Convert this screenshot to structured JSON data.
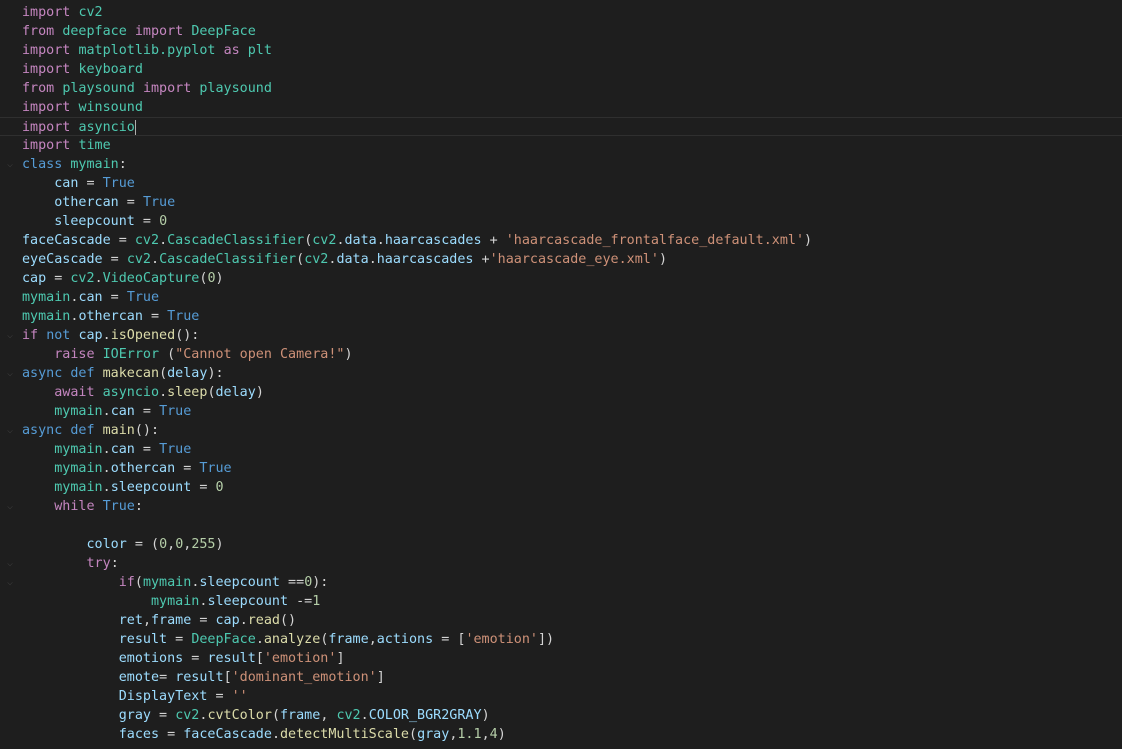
{
  "editor": {
    "theme": {
      "background": "#1e1e1e",
      "default": "#d4d4d4",
      "keyword": "#c586c0",
      "storage": "#569cd6",
      "function": "#dcdcaa",
      "class": "#4ec9b0",
      "variable": "#9cdcfe",
      "string": "#ce9178",
      "number": "#b5cea8",
      "dim_module": "#4ec9b0"
    },
    "cursor_line": 6,
    "lines": [
      {
        "fold": false,
        "tokens": [
          {
            "t": "import",
            "c": "keyword"
          },
          {
            "t": " "
          },
          {
            "t": "cv2",
            "c": "class"
          }
        ]
      },
      {
        "fold": false,
        "tokens": [
          {
            "t": "from",
            "c": "keyword"
          },
          {
            "t": " "
          },
          {
            "t": "deepface",
            "c": "class"
          },
          {
            "t": " "
          },
          {
            "t": "import",
            "c": "keyword"
          },
          {
            "t": " "
          },
          {
            "t": "DeepFace",
            "c": "class"
          }
        ]
      },
      {
        "fold": false,
        "tokens": [
          {
            "t": "import",
            "c": "keyword"
          },
          {
            "t": " "
          },
          {
            "t": "matplotlib.pyplot",
            "c": "class"
          },
          {
            "t": " "
          },
          {
            "t": "as",
            "c": "keyword"
          },
          {
            "t": " "
          },
          {
            "t": "plt",
            "c": "dim_module"
          }
        ]
      },
      {
        "fold": false,
        "tokens": [
          {
            "t": "import",
            "c": "keyword"
          },
          {
            "t": " "
          },
          {
            "t": "keyboard",
            "c": "dim_module"
          }
        ]
      },
      {
        "fold": false,
        "tokens": [
          {
            "t": "from",
            "c": "keyword"
          },
          {
            "t": " "
          },
          {
            "t": "playsound",
            "c": "class"
          },
          {
            "t": " "
          },
          {
            "t": "import",
            "c": "keyword"
          },
          {
            "t": " "
          },
          {
            "t": "playsound",
            "c": "class"
          }
        ]
      },
      {
        "fold": false,
        "tokens": [
          {
            "t": "import",
            "c": "keyword"
          },
          {
            "t": " "
          },
          {
            "t": "winsound",
            "c": "class"
          }
        ]
      },
      {
        "fold": false,
        "tokens": [
          {
            "t": "import",
            "c": "keyword"
          },
          {
            "t": " "
          },
          {
            "t": "asyncio",
            "c": "class"
          }
        ]
      },
      {
        "fold": false,
        "tokens": [
          {
            "t": "import",
            "c": "keyword"
          },
          {
            "t": " "
          },
          {
            "t": "time",
            "c": "dim_module"
          }
        ]
      },
      {
        "fold": true,
        "tokens": [
          {
            "t": "class",
            "c": "storage"
          },
          {
            "t": " "
          },
          {
            "t": "mymain",
            "c": "class"
          },
          {
            "t": ":"
          }
        ]
      },
      {
        "fold": false,
        "tokens": [
          {
            "t": "    "
          },
          {
            "t": "can",
            "c": "variable"
          },
          {
            "t": " = "
          },
          {
            "t": "True",
            "c": "storage"
          }
        ]
      },
      {
        "fold": false,
        "tokens": [
          {
            "t": "    "
          },
          {
            "t": "othercan",
            "c": "variable"
          },
          {
            "t": " = "
          },
          {
            "t": "True",
            "c": "storage"
          }
        ]
      },
      {
        "fold": false,
        "tokens": [
          {
            "t": "    "
          },
          {
            "t": "sleepcount",
            "c": "variable"
          },
          {
            "t": " = "
          },
          {
            "t": "0",
            "c": "number"
          }
        ]
      },
      {
        "fold": false,
        "tokens": [
          {
            "t": "faceCascade",
            "c": "variable"
          },
          {
            "t": " = "
          },
          {
            "t": "cv2",
            "c": "class"
          },
          {
            "t": "."
          },
          {
            "t": "CascadeClassifier",
            "c": "class"
          },
          {
            "t": "("
          },
          {
            "t": "cv2",
            "c": "class"
          },
          {
            "t": "."
          },
          {
            "t": "data",
            "c": "variable"
          },
          {
            "t": "."
          },
          {
            "t": "haarcascades",
            "c": "variable"
          },
          {
            "t": " + "
          },
          {
            "t": "'haarcascade_frontalface_default.xml'",
            "c": "string"
          },
          {
            "t": ")"
          }
        ]
      },
      {
        "fold": false,
        "tokens": [
          {
            "t": "eyeCascade",
            "c": "variable"
          },
          {
            "t": " = "
          },
          {
            "t": "cv2",
            "c": "class"
          },
          {
            "t": "."
          },
          {
            "t": "CascadeClassifier",
            "c": "class"
          },
          {
            "t": "("
          },
          {
            "t": "cv2",
            "c": "class"
          },
          {
            "t": "."
          },
          {
            "t": "data",
            "c": "variable"
          },
          {
            "t": "."
          },
          {
            "t": "haarcascades",
            "c": "variable"
          },
          {
            "t": " +"
          },
          {
            "t": "'haarcascade_eye.xml'",
            "c": "string"
          },
          {
            "t": ")"
          }
        ]
      },
      {
        "fold": false,
        "tokens": [
          {
            "t": "cap",
            "c": "variable"
          },
          {
            "t": " = "
          },
          {
            "t": "cv2",
            "c": "class"
          },
          {
            "t": "."
          },
          {
            "t": "VideoCapture",
            "c": "class"
          },
          {
            "t": "("
          },
          {
            "t": "0",
            "c": "number"
          },
          {
            "t": ")"
          }
        ]
      },
      {
        "fold": false,
        "tokens": [
          {
            "t": "mymain",
            "c": "class"
          },
          {
            "t": "."
          },
          {
            "t": "can",
            "c": "variable"
          },
          {
            "t": " = "
          },
          {
            "t": "True",
            "c": "storage"
          }
        ]
      },
      {
        "fold": false,
        "tokens": [
          {
            "t": "mymain",
            "c": "class"
          },
          {
            "t": "."
          },
          {
            "t": "othercan",
            "c": "variable"
          },
          {
            "t": " = "
          },
          {
            "t": "True",
            "c": "storage"
          }
        ]
      },
      {
        "fold": true,
        "tokens": [
          {
            "t": "if",
            "c": "keyword"
          },
          {
            "t": " "
          },
          {
            "t": "not",
            "c": "storage"
          },
          {
            "t": " "
          },
          {
            "t": "cap",
            "c": "variable"
          },
          {
            "t": "."
          },
          {
            "t": "isOpened",
            "c": "function"
          },
          {
            "t": "():"
          }
        ]
      },
      {
        "fold": false,
        "tokens": [
          {
            "t": "    "
          },
          {
            "t": "raise",
            "c": "keyword"
          },
          {
            "t": " "
          },
          {
            "t": "IOError",
            "c": "class"
          },
          {
            "t": " ("
          },
          {
            "t": "\"Cannot open Camera!\"",
            "c": "string"
          },
          {
            "t": ")"
          }
        ]
      },
      {
        "fold": true,
        "tokens": [
          {
            "t": "async",
            "c": "storage"
          },
          {
            "t": " "
          },
          {
            "t": "def",
            "c": "storage"
          },
          {
            "t": " "
          },
          {
            "t": "makecan",
            "c": "function"
          },
          {
            "t": "("
          },
          {
            "t": "delay",
            "c": "variable"
          },
          {
            "t": "):"
          }
        ]
      },
      {
        "fold": false,
        "tokens": [
          {
            "t": "    "
          },
          {
            "t": "await",
            "c": "keyword"
          },
          {
            "t": " "
          },
          {
            "t": "asyncio",
            "c": "class"
          },
          {
            "t": "."
          },
          {
            "t": "sleep",
            "c": "function"
          },
          {
            "t": "("
          },
          {
            "t": "delay",
            "c": "variable"
          },
          {
            "t": ")"
          }
        ]
      },
      {
        "fold": false,
        "tokens": [
          {
            "t": "    "
          },
          {
            "t": "mymain",
            "c": "class"
          },
          {
            "t": "."
          },
          {
            "t": "can",
            "c": "variable"
          },
          {
            "t": " = "
          },
          {
            "t": "True",
            "c": "storage"
          }
        ]
      },
      {
        "fold": true,
        "tokens": [
          {
            "t": "async",
            "c": "storage"
          },
          {
            "t": " "
          },
          {
            "t": "def",
            "c": "storage"
          },
          {
            "t": " "
          },
          {
            "t": "main",
            "c": "function"
          },
          {
            "t": "():"
          }
        ]
      },
      {
        "fold": false,
        "tokens": [
          {
            "t": "    "
          },
          {
            "t": "mymain",
            "c": "class"
          },
          {
            "t": "."
          },
          {
            "t": "can",
            "c": "variable"
          },
          {
            "t": " = "
          },
          {
            "t": "True",
            "c": "storage"
          }
        ]
      },
      {
        "fold": false,
        "tokens": [
          {
            "t": "    "
          },
          {
            "t": "mymain",
            "c": "class"
          },
          {
            "t": "."
          },
          {
            "t": "othercan",
            "c": "variable"
          },
          {
            "t": " = "
          },
          {
            "t": "True",
            "c": "storage"
          }
        ]
      },
      {
        "fold": false,
        "tokens": [
          {
            "t": "    "
          },
          {
            "t": "mymain",
            "c": "class"
          },
          {
            "t": "."
          },
          {
            "t": "sleepcount",
            "c": "variable"
          },
          {
            "t": " = "
          },
          {
            "t": "0",
            "c": "number"
          }
        ]
      },
      {
        "fold": true,
        "tokens": [
          {
            "t": "    "
          },
          {
            "t": "while",
            "c": "keyword"
          },
          {
            "t": " "
          },
          {
            "t": "True",
            "c": "storage"
          },
          {
            "t": ":"
          }
        ]
      },
      {
        "fold": false,
        "tokens": []
      },
      {
        "fold": false,
        "tokens": [
          {
            "t": "        "
          },
          {
            "t": "color",
            "c": "variable"
          },
          {
            "t": " = ("
          },
          {
            "t": "0",
            "c": "number"
          },
          {
            "t": ","
          },
          {
            "t": "0",
            "c": "number"
          },
          {
            "t": ","
          },
          {
            "t": "255",
            "c": "number"
          },
          {
            "t": ")"
          }
        ]
      },
      {
        "fold": true,
        "tokens": [
          {
            "t": "        "
          },
          {
            "t": "try",
            "c": "keyword"
          },
          {
            "t": ":"
          }
        ]
      },
      {
        "fold": true,
        "tokens": [
          {
            "t": "            "
          },
          {
            "t": "if",
            "c": "keyword"
          },
          {
            "t": "("
          },
          {
            "t": "mymain",
            "c": "class"
          },
          {
            "t": "."
          },
          {
            "t": "sleepcount",
            "c": "variable"
          },
          {
            "t": " =="
          },
          {
            "t": "0",
            "c": "number"
          },
          {
            "t": "):"
          }
        ]
      },
      {
        "fold": false,
        "tokens": [
          {
            "t": "                "
          },
          {
            "t": "mymain",
            "c": "class"
          },
          {
            "t": "."
          },
          {
            "t": "sleepcount",
            "c": "variable"
          },
          {
            "t": " -="
          },
          {
            "t": "1",
            "c": "number"
          }
        ]
      },
      {
        "fold": false,
        "tokens": [
          {
            "t": "            "
          },
          {
            "t": "ret",
            "c": "variable"
          },
          {
            "t": ","
          },
          {
            "t": "frame",
            "c": "variable"
          },
          {
            "t": " = "
          },
          {
            "t": "cap",
            "c": "variable"
          },
          {
            "t": "."
          },
          {
            "t": "read",
            "c": "function"
          },
          {
            "t": "()"
          }
        ]
      },
      {
        "fold": false,
        "tokens": [
          {
            "t": "            "
          },
          {
            "t": "result",
            "c": "variable"
          },
          {
            "t": " = "
          },
          {
            "t": "DeepFace",
            "c": "class"
          },
          {
            "t": "."
          },
          {
            "t": "analyze",
            "c": "function"
          },
          {
            "t": "("
          },
          {
            "t": "frame",
            "c": "variable"
          },
          {
            "t": ","
          },
          {
            "t": "actions",
            "c": "variable"
          },
          {
            "t": " = ["
          },
          {
            "t": "'emotion'",
            "c": "string"
          },
          {
            "t": "])"
          }
        ]
      },
      {
        "fold": false,
        "tokens": [
          {
            "t": "            "
          },
          {
            "t": "emotions",
            "c": "variable"
          },
          {
            "t": " = "
          },
          {
            "t": "result",
            "c": "variable"
          },
          {
            "t": "["
          },
          {
            "t": "'emotion'",
            "c": "string"
          },
          {
            "t": "]"
          }
        ]
      },
      {
        "fold": false,
        "tokens": [
          {
            "t": "            "
          },
          {
            "t": "emote",
            "c": "variable"
          },
          {
            "t": "= "
          },
          {
            "t": "result",
            "c": "variable"
          },
          {
            "t": "["
          },
          {
            "t": "'dominant_emotion'",
            "c": "string"
          },
          {
            "t": "]"
          }
        ]
      },
      {
        "fold": false,
        "tokens": [
          {
            "t": "            "
          },
          {
            "t": "DisplayText",
            "c": "variable"
          },
          {
            "t": " = "
          },
          {
            "t": "''",
            "c": "string"
          }
        ]
      },
      {
        "fold": false,
        "tokens": [
          {
            "t": "            "
          },
          {
            "t": "gray",
            "c": "variable"
          },
          {
            "t": " = "
          },
          {
            "t": "cv2",
            "c": "class"
          },
          {
            "t": "."
          },
          {
            "t": "cvtColor",
            "c": "function"
          },
          {
            "t": "("
          },
          {
            "t": "frame",
            "c": "variable"
          },
          {
            "t": ", "
          },
          {
            "t": "cv2",
            "c": "class"
          },
          {
            "t": "."
          },
          {
            "t": "COLOR_BGR2GRAY",
            "c": "variable"
          },
          {
            "t": ")"
          }
        ]
      },
      {
        "fold": false,
        "tokens": [
          {
            "t": "            "
          },
          {
            "t": "faces",
            "c": "variable"
          },
          {
            "t": " = "
          },
          {
            "t": "faceCascade",
            "c": "variable"
          },
          {
            "t": "."
          },
          {
            "t": "detectMultiScale",
            "c": "function"
          },
          {
            "t": "("
          },
          {
            "t": "gray",
            "c": "variable"
          },
          {
            "t": ","
          },
          {
            "t": "1.1",
            "c": "number"
          },
          {
            "t": ","
          },
          {
            "t": "4",
            "c": "number"
          },
          {
            "t": ")"
          }
        ]
      }
    ]
  }
}
